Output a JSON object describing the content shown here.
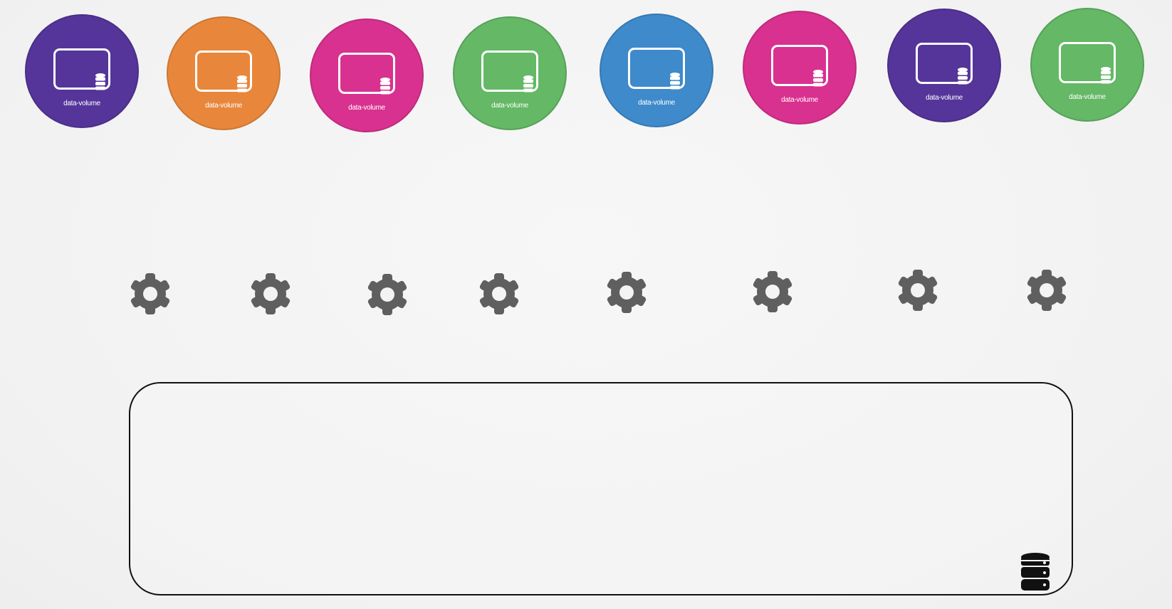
{
  "pods": [
    {
      "label": "data-volume",
      "color": "#55359a"
    },
    {
      "label": "data-volume",
      "color": "#e8873b"
    },
    {
      "label": "data-volume",
      "color": "#d9318f"
    },
    {
      "label": "data-volume",
      "color": "#64b866"
    },
    {
      "label": "data-volume",
      "color": "#3e8acb"
    },
    {
      "label": "data-volume",
      "color": "#d9318f"
    },
    {
      "label": "data-volume",
      "color": "#55359a"
    },
    {
      "label": "data-volume",
      "color": "#64b866"
    }
  ],
  "pod_icon": "screen-icon",
  "volume_icon": "database-icon",
  "node_icon": "gear-icon",
  "node_count": 8,
  "storage_icon": "database-icon",
  "gear_color": "#5f5f5f",
  "box_border_color": "#111111"
}
